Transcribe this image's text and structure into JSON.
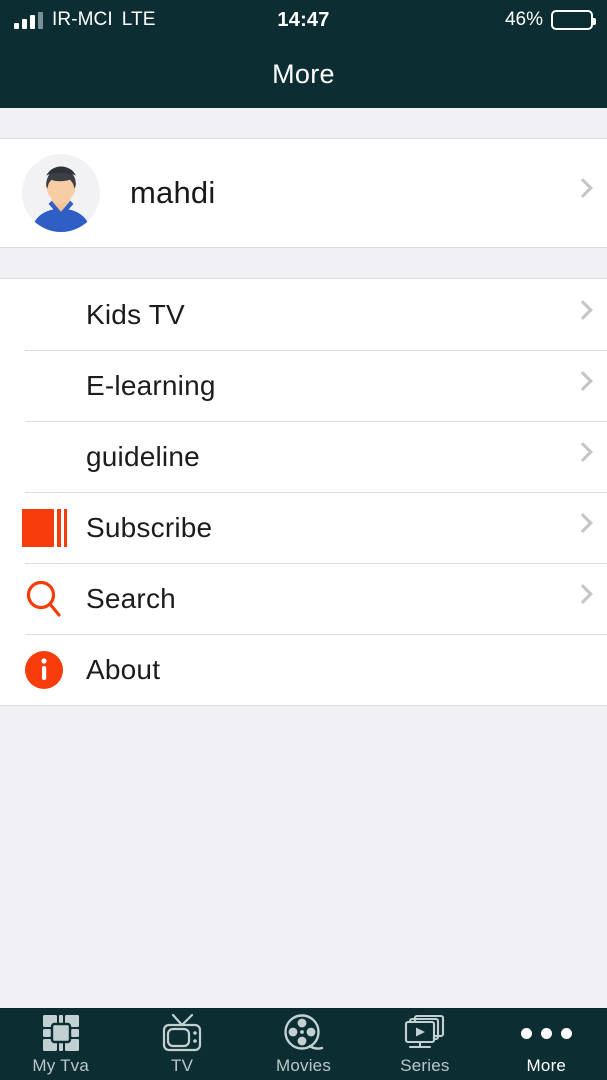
{
  "status_bar": {
    "carrier": "IR-MCI",
    "radio": "LTE",
    "time": "14:47",
    "battery_percent": "46%",
    "battery_level": 46,
    "signal_bars_filled": 3,
    "signal_bars_total": 4
  },
  "navbar": {
    "title": "More"
  },
  "profile": {
    "name": "mahdi",
    "avatar_icon": "user-avatar-illustration",
    "chevron_icon": "chevron-right-icon"
  },
  "menu": {
    "items": [
      {
        "label": "Kids TV",
        "icon": "",
        "chevron": true,
        "name": "kids-tv"
      },
      {
        "label": "E-learning",
        "icon": "",
        "chevron": true,
        "name": "e-learning"
      },
      {
        "label": "guideline",
        "icon": "",
        "chevron": true,
        "name": "guideline"
      },
      {
        "label": "Subscribe",
        "icon": "subscribe-icon",
        "chevron": true,
        "name": "subscribe"
      },
      {
        "label": "Search",
        "icon": "search-icon",
        "chevron": true,
        "name": "search"
      },
      {
        "label": "About",
        "icon": "info-icon",
        "chevron": false,
        "name": "about"
      }
    ]
  },
  "tabbar": {
    "tabs": [
      {
        "label": "My Tva",
        "icon": "grid-icon",
        "active": false
      },
      {
        "label": "TV",
        "icon": "television-icon",
        "active": false
      },
      {
        "label": "Movies",
        "icon": "film-reel-icon",
        "active": false
      },
      {
        "label": "Series",
        "icon": "screens-play-icon",
        "active": false
      },
      {
        "label": "More",
        "icon": "ellipsis-icon",
        "active": true
      }
    ]
  },
  "colors": {
    "header_bg": "#0c2e33",
    "accent": "#f63c0b",
    "page_bg": "#f0f0f5",
    "row_bg": "#ffffff",
    "separator": "#dcdce0",
    "chevron": "#c4c4c9",
    "tab_inactive": "#b9c7c9",
    "tab_active": "#ffffff"
  }
}
